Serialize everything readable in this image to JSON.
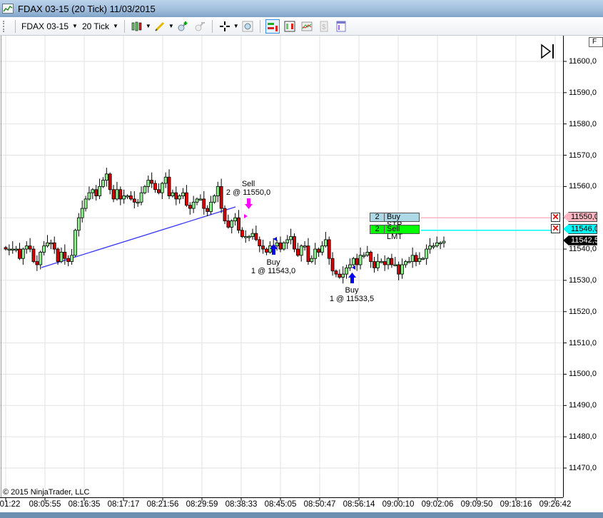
{
  "window": {
    "title": "FDAX 03-15 (20 Tick)  11/03/2015"
  },
  "toolbar": {
    "instrument": "FDAX 03-15",
    "period": "20 Tick",
    "icons": [
      "chart-style-icon",
      "drawing-pencil-icon",
      "zoom-in-icon",
      "zoom-out-icon",
      "crosshair-icon",
      "data-box-icon",
      "chart-trader-icon",
      "bar-chart-icon",
      "indicators-icon",
      "strategies-icon",
      "properties-icon"
    ]
  },
  "price_axis": {
    "labels": [
      "11600,0",
      "11590,0",
      "11580,0",
      "11570,0",
      "11560,0",
      "11550,0",
      "11540,0",
      "11530,0",
      "11520,0",
      "11510,0",
      "11500,0",
      "11490,0",
      "11480,0",
      "11470,0"
    ],
    "max": 11600,
    "min": 11470
  },
  "time_axis": {
    "labels": [
      "01:22",
      "08:05:55",
      "08:16:35",
      "08:17:17",
      "08:21:56",
      "08:29:59",
      "08:38:33",
      "08:45:05",
      "08:50:47",
      "08:56:14",
      "09:00:10",
      "09:02:06",
      "09:09:50",
      "09:18:16",
      "09:26:42"
    ]
  },
  "copyright": "© 2015 NinjaTrader, LLC",
  "orders": [
    {
      "qty": "2",
      "label": "Buy STP",
      "price": "11550,0",
      "price_value": 11550,
      "tag_color": "#add8e6",
      "line_color": "#ffb6c1"
    },
    {
      "qty": "2",
      "label": "Sell LMT",
      "price": "11546,0",
      "price_value": 11546,
      "tag_color": "#00ff00",
      "line_color": "#00ffff"
    }
  ],
  "last_price": {
    "text": "11542,5",
    "value": 11542.5
  },
  "executions": [
    {
      "title": "Sell",
      "detail": "2 @ 11550,0"
    },
    {
      "title": "Buy",
      "detail": "1 @ 11543,0"
    },
    {
      "title": "Buy",
      "detail": "1 @ 11533,5"
    }
  ],
  "colors": {
    "up": "#90ee90",
    "down": "#dd0000",
    "trendline": "#3333ff"
  },
  "closes": [
    11540,
    11540,
    11540,
    11540,
    11537,
    11540,
    11541,
    11540,
    11536,
    11535,
    11539,
    11541,
    11542,
    11542,
    11540,
    11536,
    11539,
    11537,
    11536,
    11538,
    11546,
    11550,
    11553,
    11556,
    11558,
    11559,
    11557,
    11560,
    11562,
    11564,
    11559,
    11556,
    11559,
    11556,
    11557,
    11557,
    11556,
    11555,
    11555,
    11558,
    11560,
    11562,
    11561,
    11559,
    11558,
    11561,
    11563,
    11557,
    11558,
    11556,
    11557,
    11558,
    11554,
    11553,
    11555,
    11556,
    11556,
    11553,
    11552,
    11555,
    11557,
    11560,
    11553,
    11549,
    11547,
    11549,
    11550,
    11546,
    11544,
    11544,
    11544,
    11545,
    11543,
    11541,
    11540,
    11539,
    11541,
    11541,
    11542,
    11540,
    11542,
    11543,
    11544,
    11540,
    11538,
    11541,
    11541,
    11536,
    11537,
    11540,
    11539,
    11541,
    11543,
    11537,
    11533,
    11532,
    11531,
    11532,
    11534,
    11535,
    11537,
    11535,
    11538,
    11538,
    11539,
    11536,
    11534,
    11536,
    11536,
    11535,
    11537,
    11535,
    11535,
    11532,
    11535,
    11536,
    11536,
    11538,
    11536,
    11537,
    11537,
    11540,
    11541,
    11541,
    11542,
    11542,
    11542.5
  ]
}
